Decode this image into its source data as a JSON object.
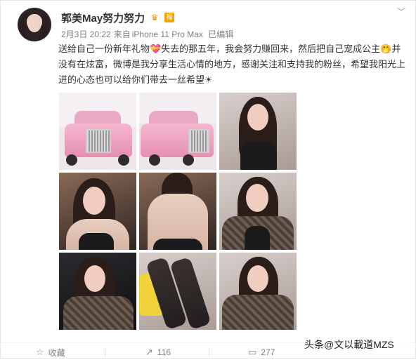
{
  "user": {
    "name": "郭美May努力努力",
    "badge_vip_text": "福"
  },
  "meta": {
    "date": "2月3日 20:22",
    "source_prefix": "来自",
    "device": "iPhone 11 Pro Max",
    "edited": "已编辑"
  },
  "post": {
    "text": "送给自己一份新年礼物💝失去的那五年，我会努力赚回来，然后把自己宠成公主🤭并没有在炫富，微博是我分享生活心情的地方，感谢关注和支持我的粉丝，希望我阳光上进的心态也可以给你们带去一丝希望☀"
  },
  "gallery": {
    "images": [
      {
        "icon": "car-photo"
      },
      {
        "icon": "car-photo"
      },
      {
        "icon": "portrait-photo"
      },
      {
        "icon": "portrait-photo"
      },
      {
        "icon": "back-photo"
      },
      {
        "icon": "portrait-photo"
      },
      {
        "icon": "portrait-photo"
      },
      {
        "icon": "legs-photo"
      },
      {
        "icon": "portrait-photo"
      }
    ]
  },
  "actions": {
    "favorite_label": "收藏",
    "repost_count": "116",
    "comment_count": "277"
  },
  "watermark": {
    "text": "头条@文以載道MZS"
  }
}
